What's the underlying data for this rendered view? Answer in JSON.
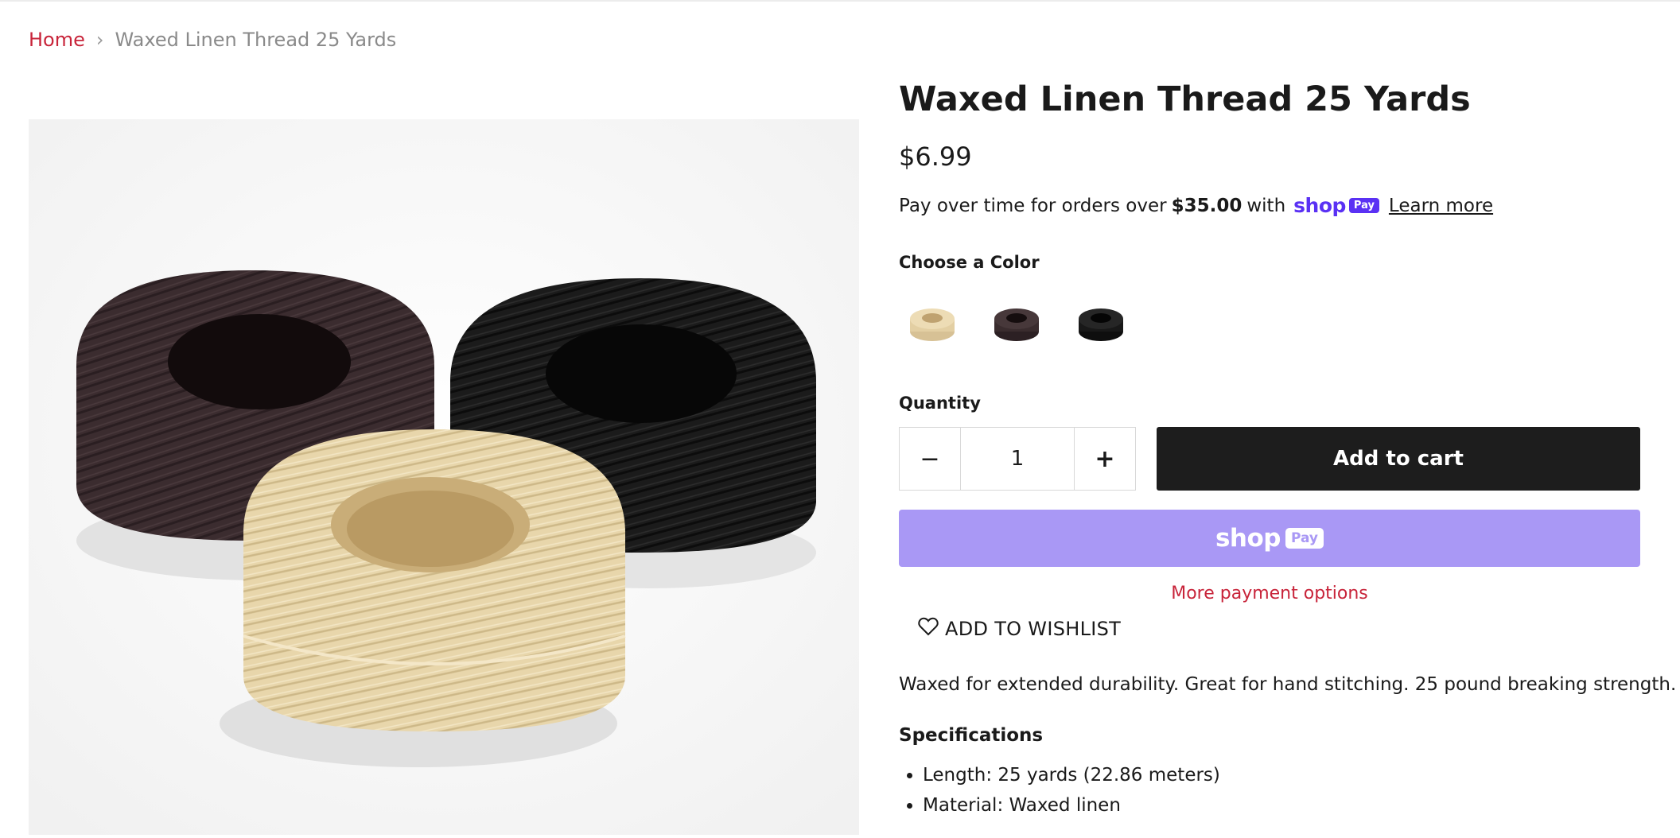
{
  "breadcrumb": {
    "home": "Home",
    "separator": "›",
    "current": "Waxed Linen Thread 25 Yards"
  },
  "product": {
    "title": "Waxed Linen Thread 25 Yards",
    "price": "$6.99",
    "installments": {
      "prefix": "Pay over time for orders over",
      "amount": "$35.00",
      "with": "with",
      "shop_word": "shop",
      "pay_pill": "Pay",
      "learn_more": "Learn more"
    },
    "color_label": "Choose a Color",
    "swatches": [
      {
        "name": "natural",
        "color": "#e3cfa3"
      },
      {
        "name": "brown",
        "color": "#3a2c2e"
      },
      {
        "name": "black",
        "color": "#181818"
      }
    ],
    "quantity_label": "Quantity",
    "quantity": "1",
    "minus_label": "−",
    "plus_label": "+",
    "add_to_cart": "Add to cart",
    "shop_pay_button": {
      "word": "shop",
      "pill": "Pay"
    },
    "more_payment_options": "More payment options",
    "wishlist": "ADD TO WISHLIST",
    "description": "Waxed for extended durability. Great for hand stitching. 25 pound breaking strength.",
    "specs_title": "Specifications",
    "specs": [
      "Length: 25 yards (22.86 meters)",
      "Material: Waxed linen"
    ]
  },
  "colors": {
    "accent_red": "#c8243a",
    "shop_purple": "#5a31f4",
    "shop_pay_button": "#a998f5",
    "cart_button": "#1d1d1d"
  },
  "icons": {
    "chevron": "chevron-right-icon",
    "heart": "heart-icon"
  }
}
